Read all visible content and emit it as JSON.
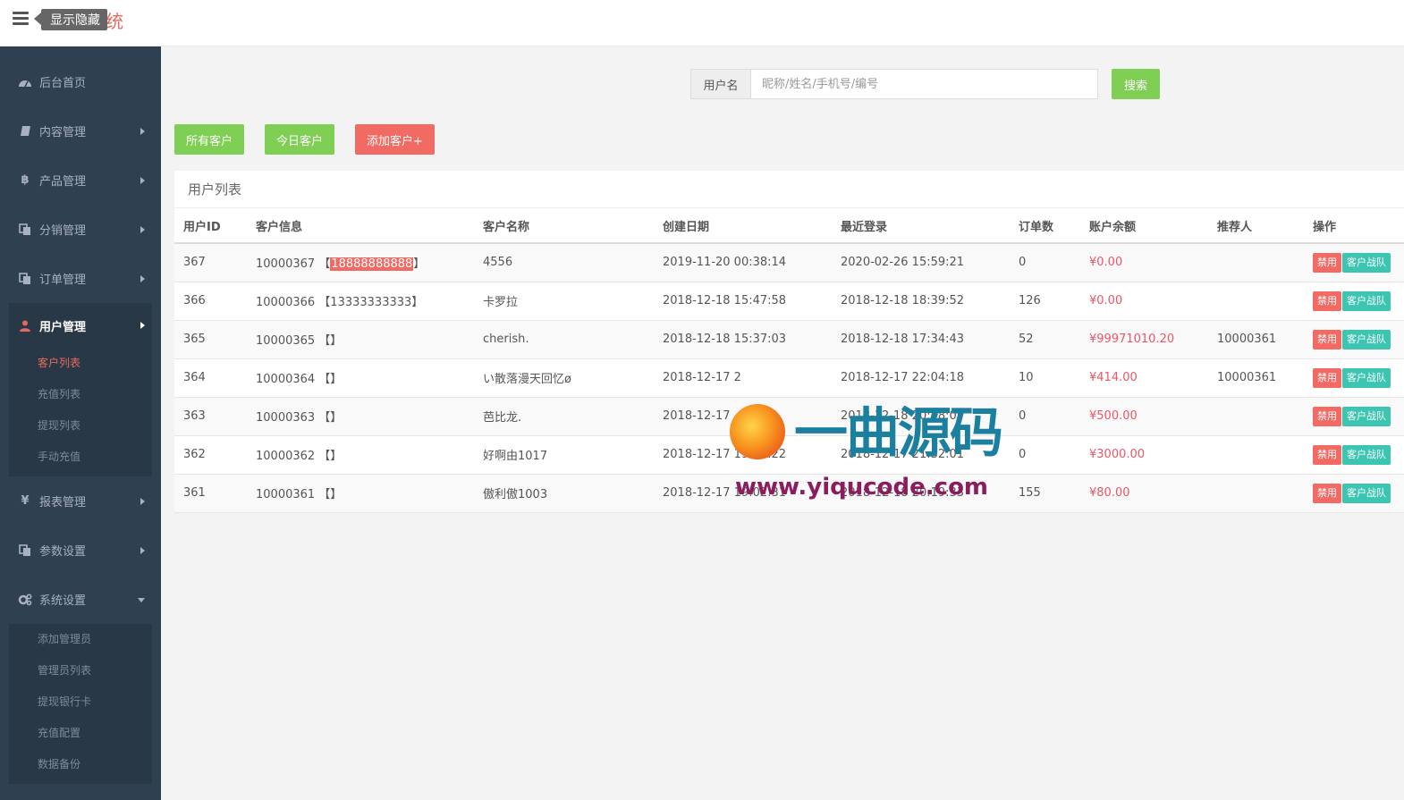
{
  "header": {
    "tag": "显示隐藏",
    "title": "统"
  },
  "sidebar": {
    "items": [
      {
        "label": "后台首页",
        "icon": "dashboard-icon"
      },
      {
        "label": "内容管理",
        "icon": "book-icon"
      },
      {
        "label": "产品管理",
        "icon": "bitcoin-icon"
      },
      {
        "label": "分销管理",
        "icon": "copy-icon"
      },
      {
        "label": "订单管理",
        "icon": "copy-icon"
      }
    ],
    "user_group": {
      "label": "用户管理",
      "icon": "user-icon",
      "sub": [
        "客户列表",
        "充值列表",
        "提现列表",
        "手动充值"
      ]
    },
    "items_after": [
      {
        "label": "报表管理",
        "icon": "yen-icon"
      },
      {
        "label": "参数设置",
        "icon": "copy-icon"
      }
    ],
    "system": {
      "label": "系统设置",
      "icon": "cogs-icon",
      "sub": [
        "添加管理员",
        "管理员列表",
        "提现银行卡",
        "充值配置",
        "数据备份"
      ]
    }
  },
  "search": {
    "addon": "用户名",
    "placeholder": "昵称/姓名/手机号/编号",
    "button": "搜索"
  },
  "filters": {
    "all": "所有客户",
    "today": "今日客户",
    "add": "添加客户+"
  },
  "panel": {
    "title": "用户列表"
  },
  "table": {
    "headers": [
      "用户ID",
      "客户信息",
      "客户名称",
      "创建日期",
      "最近登录",
      "订单数",
      "账户余额",
      "推荐人",
      "操作"
    ],
    "rows": [
      {
        "id": "367",
        "info": "10000367",
        "phone": "18888888888",
        "name": "4556",
        "created": "2019-11-20 00:38:14",
        "login": "2020-02-26 15:59:21",
        "orders": "0",
        "balance": "¥0.00",
        "ref": ""
      },
      {
        "id": "366",
        "info": "10000366",
        "phone": "13333333333",
        "name": "卡罗拉",
        "created": "2018-12-18 15:47:58",
        "login": "2018-12-18 18:39:52",
        "orders": "126",
        "balance": "¥0.00",
        "ref": ""
      },
      {
        "id": "365",
        "info": "10000365",
        "phone": "",
        "name": "cherish.",
        "created": "2018-12-18 15:37:03",
        "login": "2018-12-18 17:34:43",
        "orders": "52",
        "balance": "¥99971010.20",
        "ref": "10000361"
      },
      {
        "id": "364",
        "info": "10000364",
        "phone": "",
        "name": "い散落漫天回忆ø",
        "created": "2018-12-17 2",
        "login": "2018-12-17 22:04:18",
        "orders": "10",
        "balance": "¥414.00",
        "ref": "10000361"
      },
      {
        "id": "363",
        "info": "10000363",
        "phone": "",
        "name": "芭比龙.",
        "created": "2018-12-17",
        "login": "2018-12-18 20:48:07",
        "orders": "0",
        "balance": "¥500.00",
        "ref": ""
      },
      {
        "id": "362",
        "info": "10000362",
        "phone": "",
        "name": "好啊由1017",
        "created": "2018-12-17 19:06:22",
        "login": "2018-12-17 21:32:01",
        "orders": "0",
        "balance": "¥3000.00",
        "ref": ""
      },
      {
        "id": "361",
        "info": "10000361",
        "phone": "",
        "name": "傲利傲1003",
        "created": "2018-12-17 19:02:31",
        "login": "2018-12-18 20:19:33",
        "orders": "155",
        "balance": "¥80.00",
        "ref": ""
      }
    ],
    "op_ban": "禁用",
    "op_team": "客户战队"
  },
  "watermark": {
    "logo": "一曲源码",
    "url": "www.yiqucode.com"
  },
  "colors": {
    "accent_red": "#f16a64",
    "accent_green": "#7fcf54",
    "teal": "#3cc5b1",
    "sidebar_bg": "#2f4050"
  }
}
